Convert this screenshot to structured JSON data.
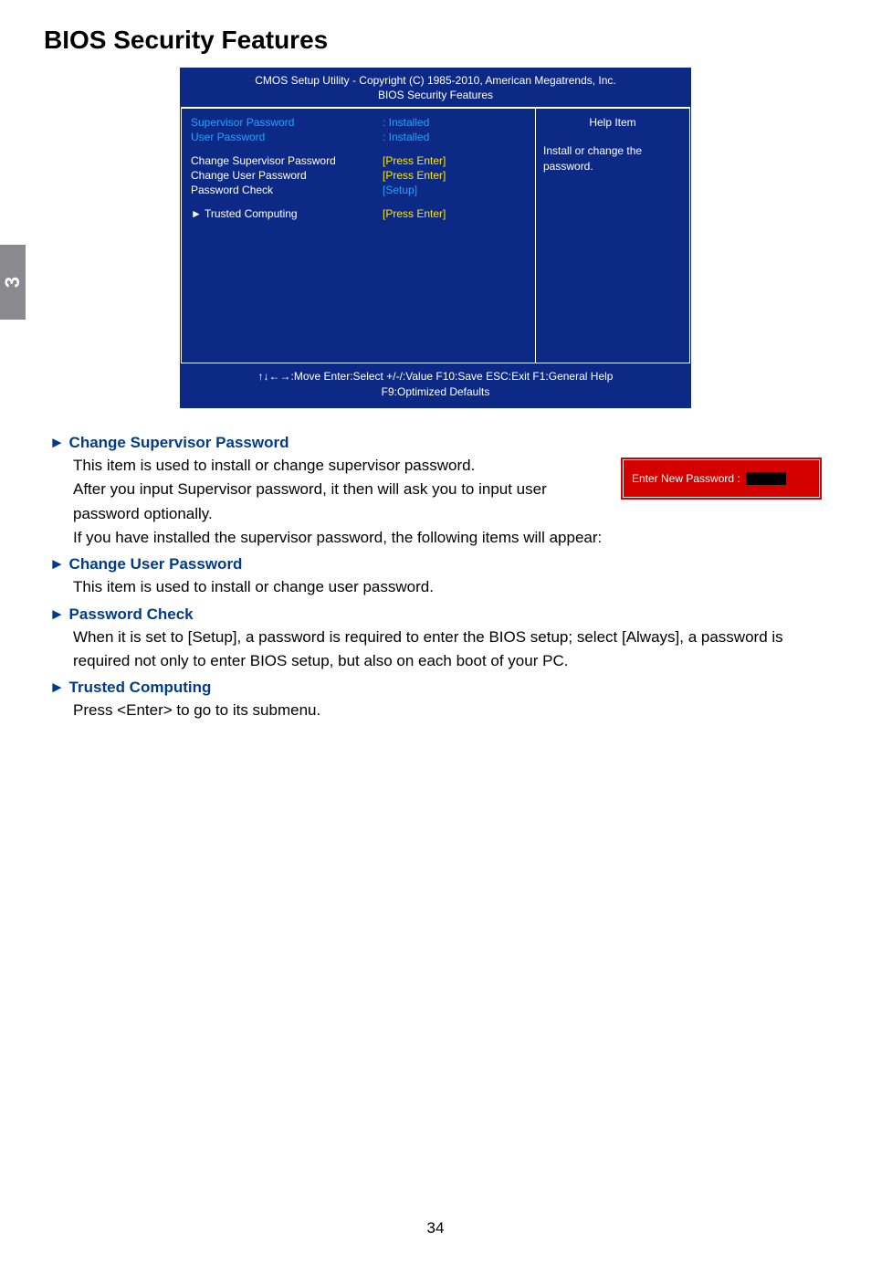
{
  "sidebar": {
    "chapter": "3"
  },
  "heading": "BIOS Security Features",
  "bios": {
    "title_line1": "CMOS Setup Utility - Copyright (C) 1985-2010, American Megatrends, Inc.",
    "title_line2": "BIOS Security Features",
    "rows": {
      "supervisor_label": "Supervisor Password",
      "supervisor_value": ": Installed",
      "user_label": "User Password",
      "user_value": ": Installed",
      "change_sup_label": "Change Supervisor Password",
      "change_sup_value": "[Press Enter]",
      "change_user_label": "Change User Password",
      "change_user_value": "[Press Enter]",
      "pwcheck_label": "Password Check",
      "pwcheck_value": "[Setup]",
      "trusted_label": "► Trusted Computing",
      "trusted_value": "[Press Enter]"
    },
    "help_title": "Help Item",
    "help_text": "Install or change the password.",
    "footer_line1": "↑↓←→:Move   Enter:Select     +/-/:Value     F10:Save       ESC:Exit     F1:General Help",
    "footer_line2": "F9:Optimized Defaults"
  },
  "dialog": {
    "label": "Enter New Password :"
  },
  "sections": {
    "change_sup": {
      "title": "► Change Supervisor Password",
      "p1": "This item is used to install or change supervisor password.",
      "p2": "After you input Supervisor password, it then will ask you to input user password optionally.",
      "p3": "If you have installed the supervisor password, the following items will appear:"
    },
    "change_user": {
      "title": "► Change User Password",
      "p1": "This item is used to install or change user password."
    },
    "pwcheck": {
      "title": "► Password Check",
      "p1": "When it is set to [Setup], a password is required to enter the BIOS setup; select [Always], a password is required not only to enter BIOS setup, but also on each boot of your PC."
    },
    "trusted": {
      "title": "► Trusted Computing",
      "p1": "Press <Enter> to go to its submenu."
    }
  },
  "page_number": "34"
}
